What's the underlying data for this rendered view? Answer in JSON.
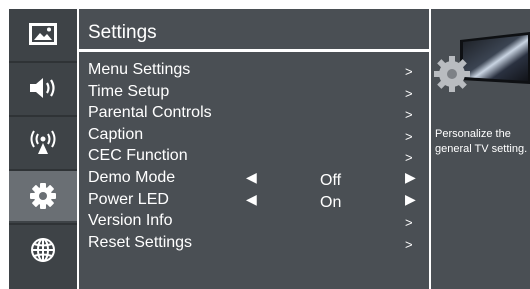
{
  "sidebar": {
    "items": [
      {
        "icon": "picture-icon"
      },
      {
        "icon": "speaker-icon"
      },
      {
        "icon": "broadcast-icon"
      },
      {
        "icon": "gear-icon",
        "active": true
      },
      {
        "icon": "globe-icon"
      }
    ]
  },
  "panel": {
    "title": "Settings",
    "menu": [
      {
        "label": "Menu Settings",
        "arrow": ">"
      },
      {
        "label": "Time Setup",
        "arrow": ">"
      },
      {
        "label": "Parental Controls",
        "arrow": ">"
      },
      {
        "label": "Caption",
        "arrow": ">"
      },
      {
        "label": "CEC Function",
        "arrow": ">"
      },
      {
        "label": "Demo Mode",
        "value": "Off",
        "left": "◀",
        "right": "▶"
      },
      {
        "label": "Power LED",
        "value": "On",
        "left": "◀",
        "right": "▶"
      },
      {
        "label": "Version Info",
        "arrow": ">"
      },
      {
        "label": "Reset Settings",
        "arrow": ">"
      }
    ]
  },
  "info": {
    "preview_icon": "gear-on-screen-icon",
    "description": "Personalize the general TV setting."
  },
  "colors": {
    "background": "#4a4f54",
    "sidebar": "#3e4347",
    "active": "#6a6f74",
    "text": "#ffffff"
  }
}
